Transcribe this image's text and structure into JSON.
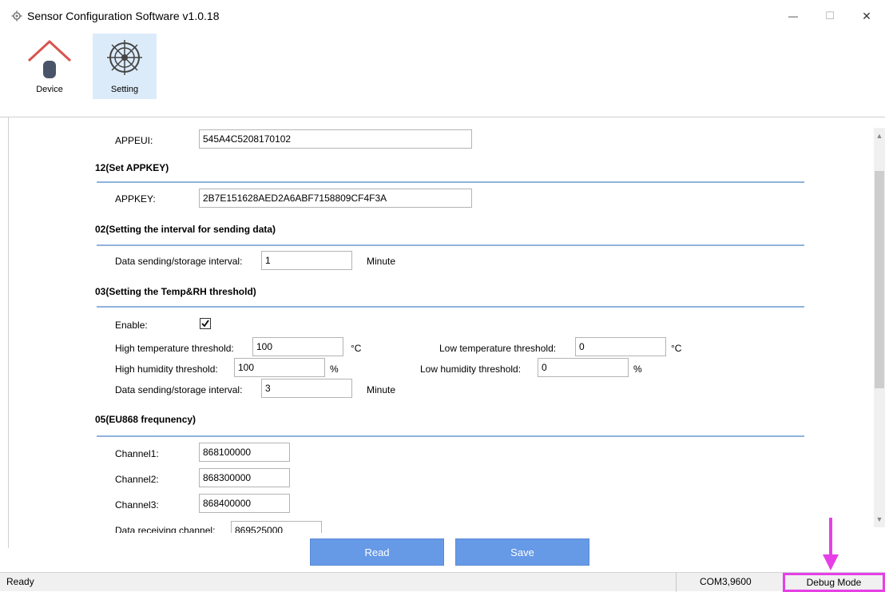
{
  "window": {
    "title": "Sensor Configuration Software v1.0.18",
    "minimize_glyph": "—",
    "maximize_glyph": "☐",
    "close_glyph": "✕"
  },
  "toolbar": {
    "device_label": "Device",
    "setting_label": "Setting"
  },
  "sections": {
    "appeui": {
      "label": "APPEUI:",
      "value": "545A4C5208170102"
    },
    "appkey": {
      "title": "12(Set APPKEY)",
      "label": "APPKEY:",
      "value": "2B7E151628AED2A6ABF7158809CF4F3A"
    },
    "interval": {
      "title": "02(Setting the interval for sending data)",
      "label": "Data sending/storage interval:",
      "value": "1",
      "unit": "Minute"
    },
    "threshold": {
      "title": "03(Setting the Temp&RH threshold)",
      "enable_label": "Enable:",
      "enable_checked": true,
      "high_temp_label": "High temperature threshold:",
      "high_temp_value": "100",
      "temp_unit": "°C",
      "low_temp_label": "Low temperature threshold:",
      "low_temp_value": "0",
      "high_hum_label": "High humidity threshold:",
      "high_hum_value": "100",
      "hum_unit": "%",
      "low_hum_label": "Low humidity threshold:",
      "low_hum_value": "0",
      "interval_label": "Data sending/storage interval:",
      "interval_value": "3",
      "interval_unit": "Minute"
    },
    "frequency": {
      "title": "05(EU868 frequnency)",
      "channels": [
        {
          "label": "Channel1:",
          "value": "868100000"
        },
        {
          "label": "Channel2:",
          "value": "868300000"
        },
        {
          "label": "Channel3:",
          "value": "868400000"
        }
      ],
      "receive_label": "Data receiving channel:",
      "receive_value": "869525000"
    }
  },
  "actions": {
    "read_label": "Read",
    "save_label": "Save"
  },
  "status": {
    "ready": "Ready",
    "port": "COM3,9600",
    "debug_mode": "Debug Mode"
  },
  "colors": {
    "accent_button": "#6699e6",
    "divider": "#8fb2dc",
    "highlight": "#e63fe6",
    "selected_tool": "#dcebf9"
  }
}
